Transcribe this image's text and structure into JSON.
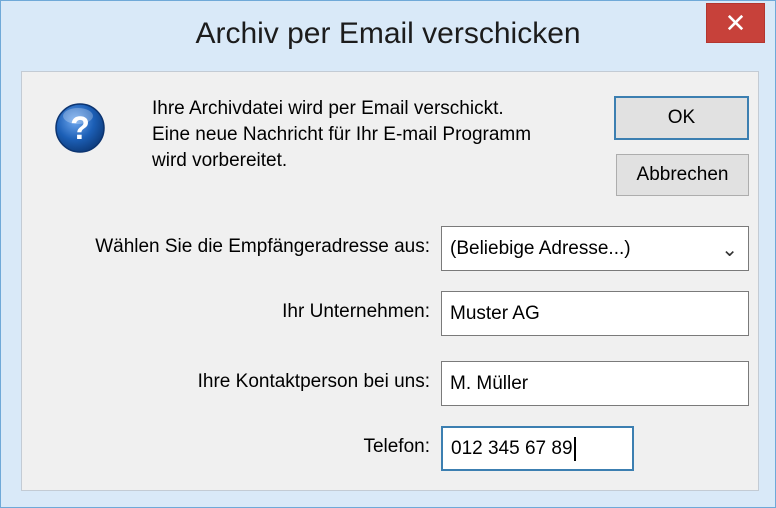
{
  "window": {
    "title": "Archiv per Email verschicken",
    "close_symbol": "✕"
  },
  "message": {
    "icon": "question-icon",
    "lines": [
      "Ihre Archivdatei wird per Email verschickt.",
      "Eine neue Nachricht für Ihr E-mail Programm",
      "wird vorbereitet."
    ]
  },
  "buttons": {
    "ok_label": "OK",
    "cancel_label": "Abbrechen"
  },
  "form": {
    "recipient": {
      "label": "Wählen Sie die Empfängeradresse aus:",
      "value": "(Beliebige Adresse...)"
    },
    "company": {
      "label": "Ihr Unternehmen:",
      "value": "Muster AG"
    },
    "contact": {
      "label": "Ihre Kontaktperson bei uns:",
      "value": "M. Müller"
    },
    "phone": {
      "label": "Telefon:",
      "value": "012 345 67 89"
    }
  },
  "colors": {
    "title_bar": "#d9e9f8",
    "close_button": "#c7413a",
    "ok_border": "#3c7fb1",
    "icon_blue": "#1c5fb6"
  }
}
